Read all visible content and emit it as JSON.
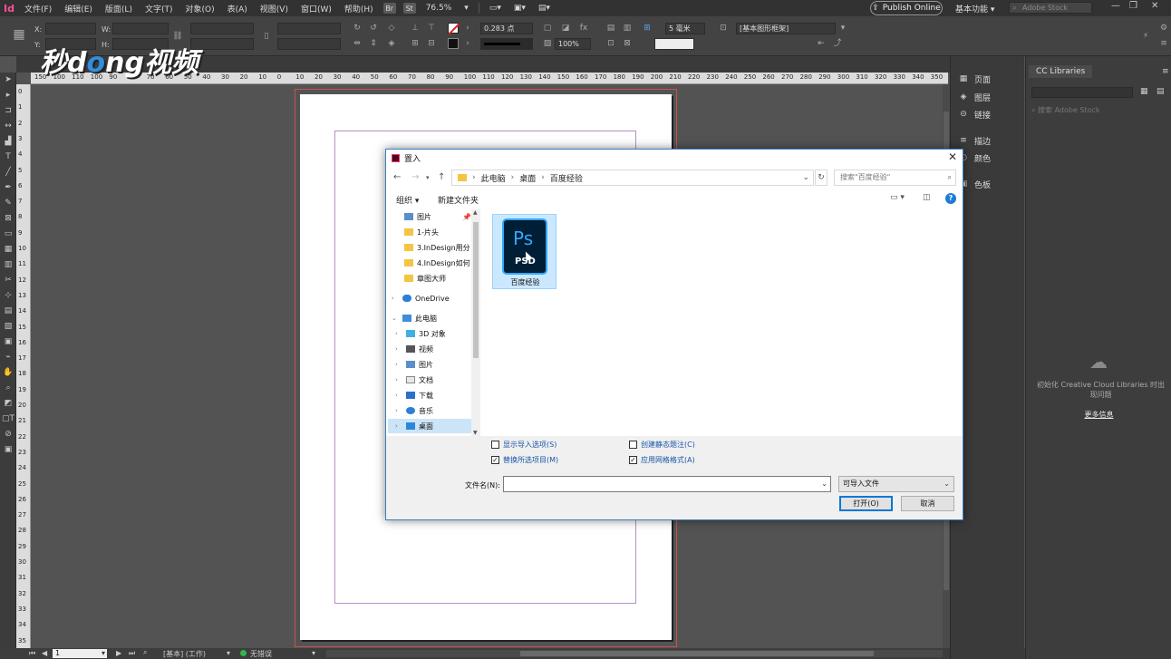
{
  "menubar": {
    "app_logo": "Id",
    "items": [
      "文件(F)",
      "编辑(E)",
      "版面(L)",
      "文字(T)",
      "对象(O)",
      "表(A)",
      "视图(V)",
      "窗口(W)",
      "帮助(H)"
    ],
    "bridge": "Br",
    "stock": "St",
    "zoom": "76.5%",
    "publish_online": "Publish Online",
    "workspace": "基本功能",
    "stock_search_placeholder": "Adobe Stock"
  },
  "controlbar": {
    "x_label": "X:",
    "y_label": "Y:",
    "w_label": "W:",
    "h_label": "H:",
    "stroke_weight": "0.283 点",
    "opacity": "100%",
    "size_value": "5 毫米",
    "frame_style": "[基本图形框架]"
  },
  "ruler": {
    "h_labels": [
      "150",
      "100",
      "110",
      "100",
      "90",
      "80",
      "70",
      "60",
      "50",
      "40",
      "30",
      "20",
      "10",
      "0",
      "10",
      "20",
      "30",
      "40",
      "50",
      "60",
      "70",
      "80",
      "90",
      "100",
      "110",
      "120",
      "130",
      "140",
      "150",
      "160",
      "170",
      "180",
      "190",
      "200",
      "210",
      "220",
      "230",
      "240",
      "250",
      "260",
      "270",
      "280",
      "290",
      "300",
      "310",
      "320",
      "330",
      "340",
      "350"
    ],
    "v_labels": [
      "0",
      "1",
      "2",
      "3",
      "4",
      "5",
      "6",
      "7",
      "8",
      "9",
      "10",
      "11",
      "12",
      "13",
      "14",
      "15",
      "16",
      "17",
      "18",
      "19",
      "20",
      "21",
      "22",
      "23",
      "24",
      "25",
      "26",
      "27",
      "28",
      "29",
      "30",
      "31",
      "32",
      "33",
      "34",
      "35"
    ]
  },
  "watermark": {
    "part1": "秒d",
    "part2": "o",
    "part3": "ng视频"
  },
  "dialog": {
    "title": "置入",
    "breadcrumb": [
      "此电脑",
      "桌面",
      "百度经验"
    ],
    "search_placeholder": "搜索\"百度经验\"",
    "organize": "组织 ▾",
    "new_folder": "新建文件夹",
    "tree": [
      {
        "label": "图片",
        "icon": "picture-icon",
        "indent": 1,
        "pinned": true
      },
      {
        "label": "1-片头",
        "icon": "folder-icon",
        "indent": 1
      },
      {
        "label": "3.InDesign用分",
        "icon": "folder-icon",
        "indent": 1
      },
      {
        "label": "4.InDesign如何",
        "icon": "folder-icon",
        "indent": 1
      },
      {
        "label": "章图大师",
        "icon": "folder-icon",
        "indent": 1
      },
      {
        "label": "OneDrive",
        "icon": "onedrive-icon",
        "indent": 0
      },
      {
        "label": "此电脑",
        "icon": "computer-icon",
        "indent": 0,
        "expanded": true
      },
      {
        "label": "3D 对象",
        "icon": "3d-objects-icon",
        "indent": 1
      },
      {
        "label": "视频",
        "icon": "video-icon",
        "indent": 1
      },
      {
        "label": "图片",
        "icon": "picture-icon",
        "indent": 1
      },
      {
        "label": "文档",
        "icon": "document-icon",
        "indent": 1
      },
      {
        "label": "下载",
        "icon": "download-icon",
        "indent": 1
      },
      {
        "label": "音乐",
        "icon": "music-icon",
        "indent": 1
      },
      {
        "label": "桌面",
        "icon": "desktop-icon",
        "indent": 1,
        "selected": true
      }
    ],
    "file": {
      "name": "百度经验",
      "type_badge": "PSD",
      "app_badge": "Ps"
    },
    "options": {
      "show_import_options": {
        "label": "显示导入选项(S)",
        "checked": false
      },
      "replace_selected": {
        "label": "替换所选项目(M)",
        "checked": true
      },
      "create_static_caption": {
        "label": "创建静态题注(C)",
        "checked": false
      },
      "apply_grid_format": {
        "label": "应用网格格式(A)",
        "checked": true
      }
    },
    "filename_label": "文件名(N):",
    "filename_value": "",
    "filter_value": "可导入文件",
    "open_button": "打开(O)",
    "cancel_button": "取消"
  },
  "panels": {
    "items": [
      {
        "label": "页面",
        "icon": "pages-icon"
      },
      {
        "label": "图层",
        "icon": "layers-icon"
      },
      {
        "label": "链接",
        "icon": "links-icon"
      },
      {
        "label": "描边",
        "icon": "stroke-icon"
      },
      {
        "label": "颜色",
        "icon": "color-icon"
      },
      {
        "label": "色板",
        "icon": "swatches-icon"
      }
    ]
  },
  "cclibraries": {
    "tab": "CC Libraries",
    "search_placeholder": "搜索 Adobe Stock",
    "message": "初始化 Creative Cloud Libraries 时出现问题",
    "more_info": "更多信息"
  },
  "statusbar": {
    "page": "1",
    "preflight_profile": "[基本] (工作)",
    "errors": "无错误"
  }
}
